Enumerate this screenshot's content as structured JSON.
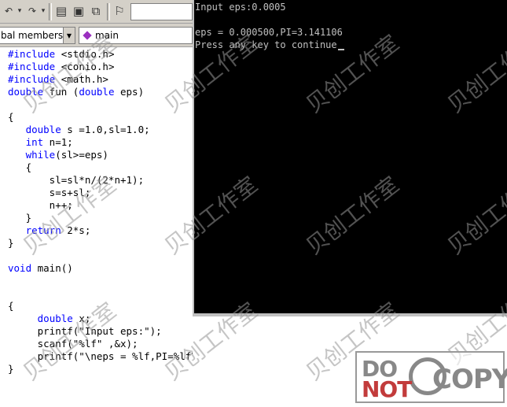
{
  "toolbar": {
    "buttons": [
      {
        "name": "undo-icon",
        "glyph": "↶"
      },
      {
        "name": "dropdown-arrow-icon",
        "glyph": "▾"
      },
      {
        "name": "redo-icon",
        "glyph": "↷"
      },
      {
        "name": "dropdown-arrow-icon",
        "glyph": "▾"
      },
      {
        "name": "workspace-icon",
        "glyph": "▤"
      },
      {
        "name": "output-icon",
        "glyph": "▣"
      },
      {
        "name": "windows-icon",
        "glyph": "⧉"
      },
      {
        "name": "find-in-files-icon",
        "glyph": "⚐"
      }
    ]
  },
  "wizard": {
    "scope": "bal members",
    "function": "main",
    "function_icon_color": "#9b30c0"
  },
  "code": [
    {
      "parts": [
        {
          "t": "#include",
          "kw": true
        },
        {
          "t": " <stdio.h>",
          "kw": false
        }
      ]
    },
    {
      "parts": [
        {
          "t": "#include",
          "kw": true
        },
        {
          "t": " <conio.h>",
          "kw": false
        }
      ]
    },
    {
      "parts": [
        {
          "t": "#include",
          "kw": true
        },
        {
          "t": " <math.h>",
          "kw": false
        }
      ]
    },
    {
      "parts": [
        {
          "t": "double",
          "kw": true
        },
        {
          "t": " fun (",
          "kw": false
        },
        {
          "t": "double",
          "kw": true
        },
        {
          "t": " eps)",
          "kw": false
        }
      ]
    },
    {
      "parts": [
        {
          "t": "",
          "kw": false
        }
      ]
    },
    {
      "parts": [
        {
          "t": "{",
          "kw": false
        }
      ]
    },
    {
      "parts": [
        {
          "t": "   ",
          "kw": false
        },
        {
          "t": "double",
          "kw": true
        },
        {
          "t": " s =1.0,sl=1.0;",
          "kw": false
        }
      ]
    },
    {
      "parts": [
        {
          "t": "   ",
          "kw": false
        },
        {
          "t": "int",
          "kw": true
        },
        {
          "t": " n=1;",
          "kw": false
        }
      ]
    },
    {
      "parts": [
        {
          "t": "   ",
          "kw": false
        },
        {
          "t": "while",
          "kw": true
        },
        {
          "t": "(sl>=eps)",
          "kw": false
        }
      ]
    },
    {
      "parts": [
        {
          "t": "   {",
          "kw": false
        }
      ]
    },
    {
      "parts": [
        {
          "t": "       sl=sl*n/(2*n+1);",
          "kw": false
        }
      ]
    },
    {
      "parts": [
        {
          "t": "       s=s+sl;",
          "kw": false
        }
      ]
    },
    {
      "parts": [
        {
          "t": "       n++;",
          "kw": false
        }
      ]
    },
    {
      "parts": [
        {
          "t": "   }",
          "kw": false
        }
      ]
    },
    {
      "parts": [
        {
          "t": "   ",
          "kw": false
        },
        {
          "t": "return",
          "kw": true
        },
        {
          "t": " 2*s;",
          "kw": false
        }
      ]
    },
    {
      "parts": [
        {
          "t": "}",
          "kw": false
        }
      ]
    },
    {
      "parts": [
        {
          "t": "",
          "kw": false
        }
      ]
    },
    {
      "parts": [
        {
          "t": "void",
          "kw": true
        },
        {
          "t": " main()",
          "kw": false
        }
      ]
    },
    {
      "parts": [
        {
          "t": "",
          "kw": false
        }
      ]
    },
    {
      "parts": [
        {
          "t": "",
          "kw": false
        }
      ]
    },
    {
      "parts": [
        {
          "t": "{",
          "kw": false
        }
      ]
    },
    {
      "parts": [
        {
          "t": "     ",
          "kw": false
        },
        {
          "t": "double",
          "kw": true
        },
        {
          "t": " x;",
          "kw": false
        }
      ]
    },
    {
      "parts": [
        {
          "t": "     printf(\"Input eps:\");",
          "kw": false
        }
      ]
    },
    {
      "parts": [
        {
          "t": "     scanf(\"%lf\" ,&x);",
          "kw": false
        }
      ]
    },
    {
      "parts": [
        {
          "t": "     printf(\"\\neps = %lf,PI=%lf\\n\",x,fun(x));",
          "kw": false
        }
      ]
    },
    {
      "parts": [
        {
          "t": "}",
          "kw": false
        }
      ]
    }
  ],
  "console": {
    "lines": [
      "Input eps:0.0005",
      "",
      "eps = 0.000500,PI=3.141106",
      "Press any key to continue"
    ]
  },
  "watermark": {
    "text": "贝创工作室"
  },
  "logo": {
    "do": "DO",
    "not": "NOT",
    "copy": "COPY"
  }
}
